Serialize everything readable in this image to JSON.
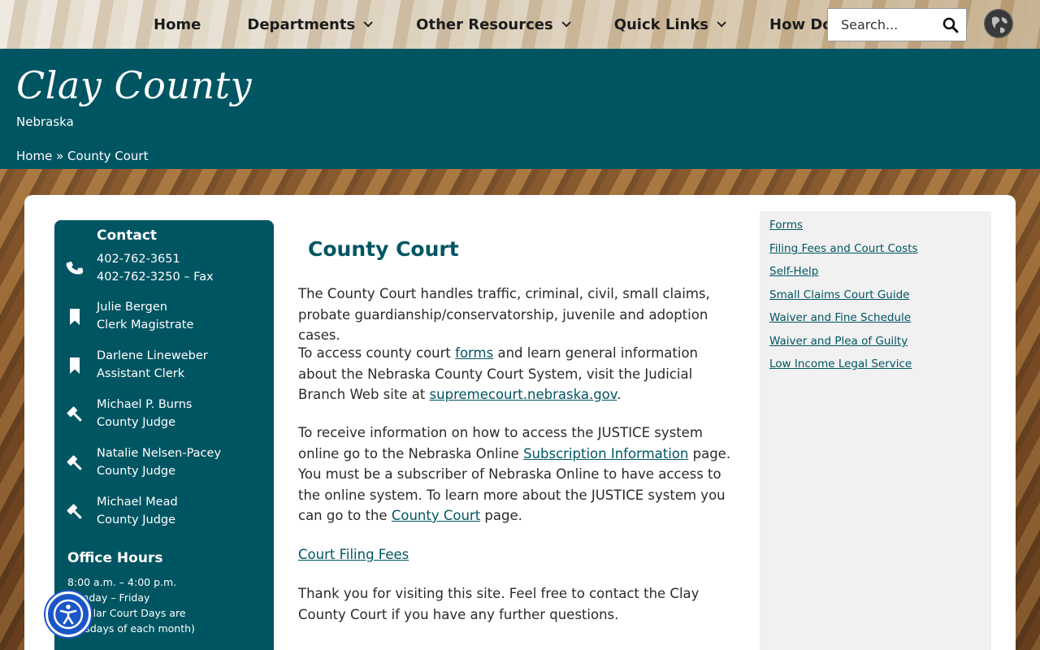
{
  "nav": {
    "items": [
      {
        "label": "Home",
        "has_dropdown": false
      },
      {
        "label": "Departments",
        "has_dropdown": true
      },
      {
        "label": "Other Resources",
        "has_dropdown": true
      },
      {
        "label": "Quick Links",
        "has_dropdown": true
      },
      {
        "label": "How Do I",
        "has_dropdown": true
      }
    ],
    "search_placeholder": "Search...",
    "search_icon": "search-icon",
    "translate_icon": "globe-icon"
  },
  "header": {
    "title": "Clay County",
    "subtitle": "Nebraska",
    "breadcrumb": {
      "home": "Home",
      "separator": "»",
      "current": "County Court"
    },
    "bg_color": "#005563"
  },
  "contact": {
    "title": "Contact",
    "entries": [
      {
        "icon": "phone-icon",
        "line1": "402-762-3651",
        "line2": "402-762-3250 – Fax"
      },
      {
        "icon": "bookmark-icon",
        "line1": "Julie Bergen",
        "line2": "Clerk Magistrate"
      },
      {
        "icon": "bookmark-icon",
        "line1": "Darlene Lineweber",
        "line2": "Assistant Clerk"
      },
      {
        "icon": "gavel-icon",
        "line1": "Michael P. Burns",
        "line2": "County Judge"
      },
      {
        "icon": "gavel-icon",
        "line1": "Natalie Nelsen-Pacey",
        "line2": "County Judge"
      },
      {
        "icon": "gavel-icon",
        "line1": "Michael Mead",
        "line2": "County Judge"
      }
    ],
    "hours_title": "Office Hours",
    "hours_lines": [
      "8:00 a.m. – 4:00 p.m.",
      "Monday – Friday",
      "Regular Court Days are",
      "Tuesdays of each month)"
    ]
  },
  "main": {
    "title": "County Court",
    "p1": "The County Court handles traffic, criminal, civil, small claims, probate guardianship/conservatorship, juvenile and adoption cases.",
    "p2_a": "To access county court ",
    "p2_link1": "forms",
    "p2_b": " and learn general information about the Nebraska County Court System, visit the Judicial Branch Web site at ",
    "p2_link2": "supremecourt.nebraska.gov",
    "p2_c": ".",
    "p3_a": "To receive information on how to access the JUSTICE system online go to the Nebraska Online ",
    "p3_link1": "Subscription Information",
    "p3_b": " page. You must be a subscriber of Nebraska Online to have access to the online system. To learn more about the JUSTICE system you can go to the ",
    "p3_link2": "County Court",
    "p3_c": " page.",
    "p4_link": "Court Filing Fees",
    "p5": "Thank you for visiting this site. Feel free to contact the Clay County Court if you have any further questions."
  },
  "sidebar": {
    "links": [
      "Forms",
      "Filing Fees and Court Costs",
      "Self-Help",
      "Small Claims Court Guide",
      "Waiver and Fine Schedule",
      "Waiver and Plea of Guilty",
      "Low Income Legal Service"
    ]
  },
  "accessibility": {
    "icon": "accessibility-icon"
  }
}
